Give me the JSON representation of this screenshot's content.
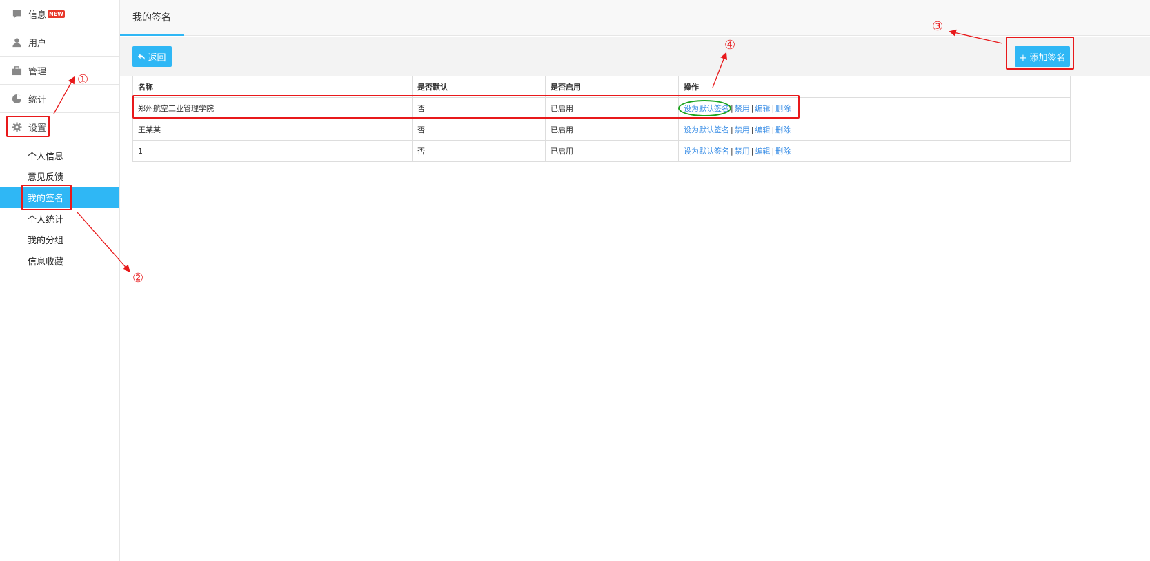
{
  "sidebar": {
    "items": [
      {
        "label": "信息",
        "icon": "chat-icon",
        "badge": "NEW"
      },
      {
        "label": "用户",
        "icon": "user-icon"
      },
      {
        "label": "管理",
        "icon": "briefcase-icon"
      },
      {
        "label": "统计",
        "icon": "pie-chart-icon"
      },
      {
        "label": "设置",
        "icon": "gear-icon"
      }
    ],
    "sub_items": [
      {
        "label": "个人信息"
      },
      {
        "label": "意见反馈"
      },
      {
        "label": "我的签名",
        "active": true
      },
      {
        "label": "个人统计"
      },
      {
        "label": "我的分组"
      },
      {
        "label": "信息收藏"
      }
    ]
  },
  "header": {
    "tab": "我的签名"
  },
  "toolbar": {
    "back_label": "返回",
    "add_label": "+ 添加签名"
  },
  "table": {
    "columns": [
      "名称",
      "是否默认",
      "是否启用",
      "操作"
    ],
    "rows": [
      {
        "name": "郑州航空工业管理学院",
        "default": "否",
        "enabled": "已启用"
      },
      {
        "name": "王某某",
        "default": "否",
        "enabled": "已启用"
      },
      {
        "name": "1",
        "default": "否",
        "enabled": "已启用"
      }
    ],
    "actions": {
      "set_default": "设为默认签名",
      "disable": "禁用",
      "edit": "编辑",
      "delete": "删除",
      "sep": "|"
    }
  },
  "annotations": {
    "n1": "①",
    "n2": "②",
    "n3": "③",
    "n4": "④",
    "color": "#e8191b",
    "ellipse_color": "#1aa31c"
  },
  "colors": {
    "accent": "#2fb7f5",
    "link": "#3a8ee6",
    "badge": "#e8382c"
  }
}
